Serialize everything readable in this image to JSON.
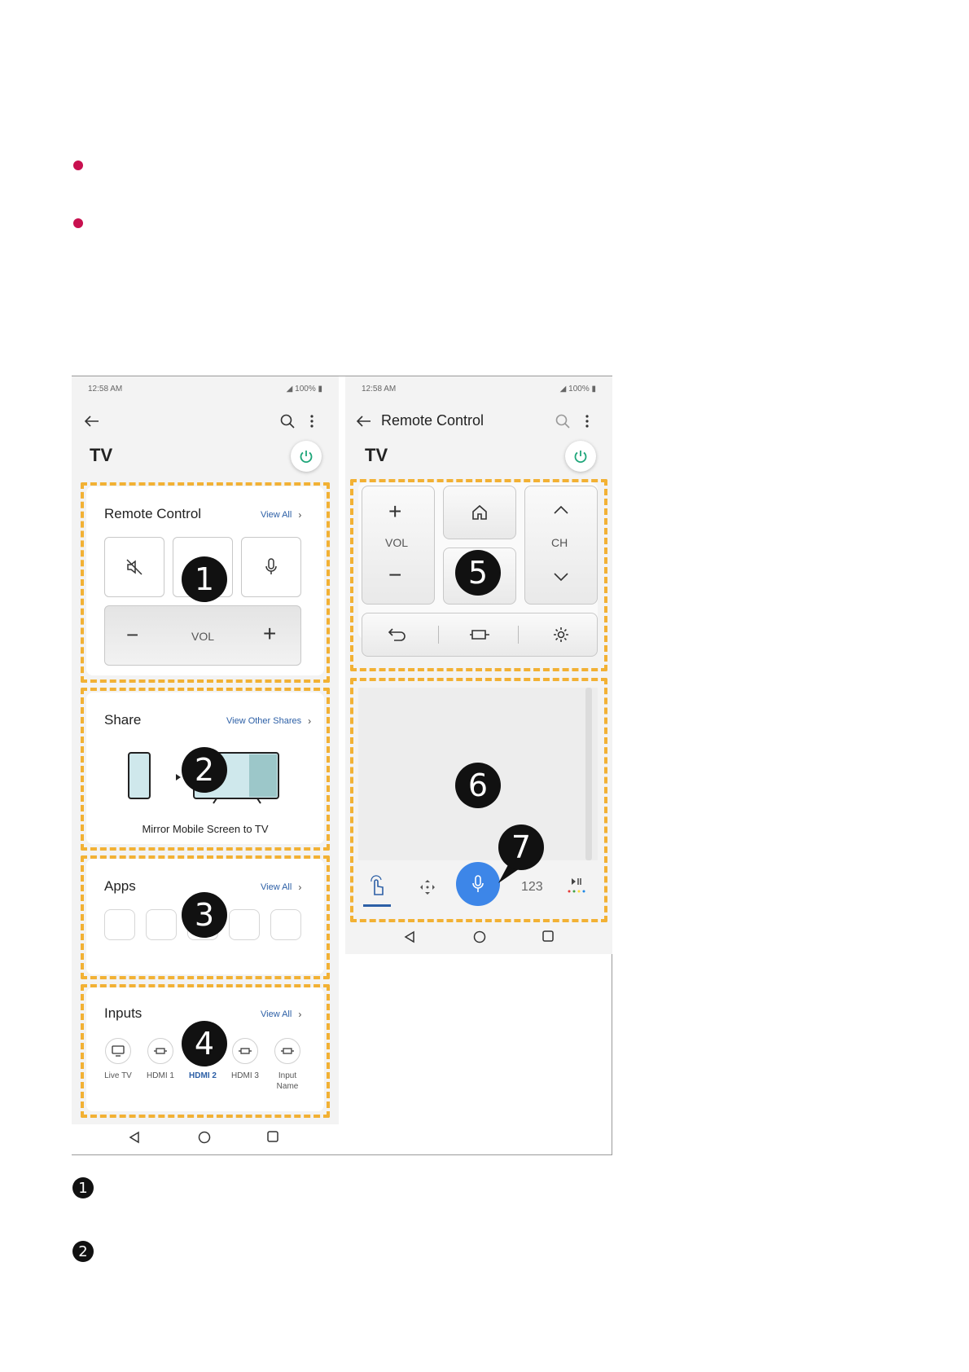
{
  "left_screen": {
    "status": {
      "time": "12:58 AM",
      "battery": "100%"
    },
    "tv_label": "TV",
    "remote_card": {
      "title": "Remote Control",
      "link": "View All",
      "vol_label": "VOL",
      "minus": "−",
      "plus": "+"
    },
    "share_card": {
      "title": "Share",
      "link": "View Other Shares",
      "caption": "Mirror Mobile Screen to TV"
    },
    "apps_card": {
      "title": "Apps",
      "link": "View All"
    },
    "inputs_card": {
      "title": "Inputs",
      "link": "View All",
      "items": [
        {
          "label": "Live TV",
          "icon": "tv-icon"
        },
        {
          "label": "HDMI 1",
          "icon": "hdmi-icon"
        },
        {
          "label": "HDMI 2",
          "icon": "hdmi-icon",
          "active": true
        },
        {
          "label": "HDMI 3",
          "icon": "hdmi-icon"
        },
        {
          "label": "Input\nName",
          "icon": "hdmi-icon"
        }
      ]
    }
  },
  "right_screen": {
    "status": {
      "time": "12:58 AM",
      "battery": "100%"
    },
    "appbar_title": "Remote Control",
    "tv_label": "TV",
    "vol_label": "VOL",
    "ch_label": "CH",
    "numpad_tab": "123"
  },
  "badges": [
    "1",
    "2",
    "3",
    "4",
    "5",
    "6",
    "7"
  ],
  "legend": [
    "1",
    "2"
  ],
  "colors": {
    "accent_dash": "#f2b134",
    "bullet": "#c8104f",
    "mic_blue": "#3d86e8",
    "link_blue": "#2c5fa6"
  }
}
